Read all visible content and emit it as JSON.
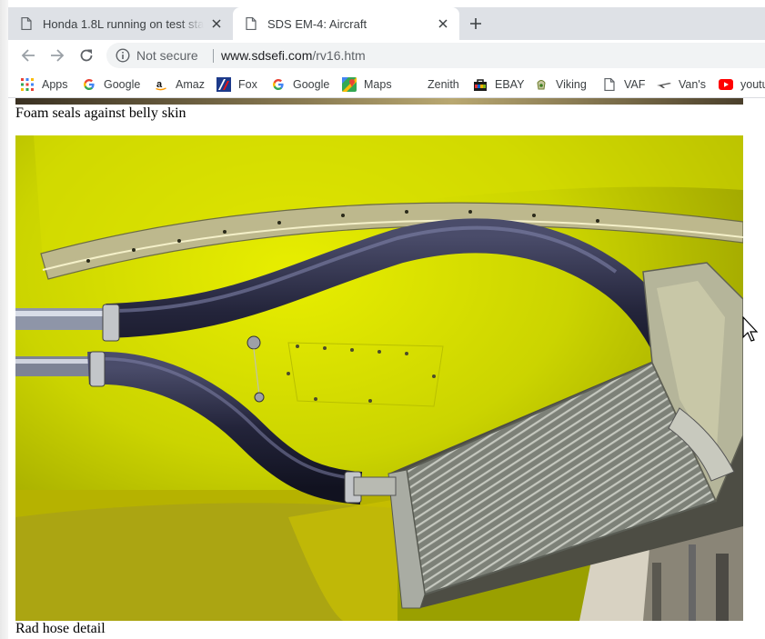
{
  "browser": {
    "tabs": [
      {
        "title": "Honda 1.8L running on test stand",
        "active": false
      },
      {
        "title": "SDS EM-4: Aircraft",
        "active": true
      }
    ],
    "address": {
      "security_label": "Not secure",
      "host": "www.sdsefi.com",
      "path": "/rv16.htm"
    },
    "bookmarks": [
      {
        "label": "Apps",
        "icon": "apps-grid-icon"
      },
      {
        "label": "Google",
        "icon": "google-icon"
      },
      {
        "label": "Amaz",
        "icon": "amazon-icon"
      },
      {
        "label": "Fox",
        "icon": "fox-icon"
      },
      {
        "label": "Google",
        "icon": "google-icon"
      },
      {
        "label": "Maps",
        "icon": "maps-icon"
      },
      {
        "label": "Zenith",
        "icon": ""
      },
      {
        "label": "EBAY",
        "icon": "ebay-icon"
      },
      {
        "label": "Viking",
        "icon": "viking-icon"
      },
      {
        "label": "VAF",
        "icon": "page-icon"
      },
      {
        "label": "Van's",
        "icon": "vans-plane-icon"
      },
      {
        "label": "youtu",
        "icon": "youtube-icon"
      }
    ]
  },
  "page": {
    "caption_top": "Foam seals against belly skin",
    "caption_bottom": "Rad hose detail",
    "photo": {
      "subject": "radiator with black hoses under yellow aircraft belly"
    }
  },
  "colors": {
    "tabstrip": "#dee1e6",
    "omnibox": "#f1f3f4",
    "belly_yellow": "#d8e000",
    "hose": "#1f2030"
  }
}
